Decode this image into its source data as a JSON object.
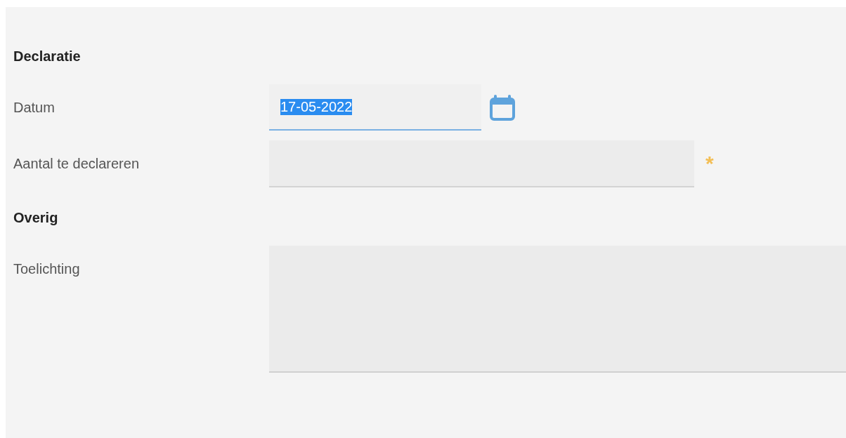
{
  "sections": [
    {
      "title": "Declaratie",
      "fields": [
        {
          "kind": "date",
          "label": "Datum",
          "value": "17-05-2022",
          "selected": true,
          "required": false
        },
        {
          "kind": "number",
          "label": "Aantal te declareren",
          "required": true,
          "required_mark": "*"
        }
      ]
    },
    {
      "title": "Overig",
      "fields": [
        {
          "kind": "textarea",
          "label": "Toelichting",
          "required": false
        }
      ]
    }
  ]
}
